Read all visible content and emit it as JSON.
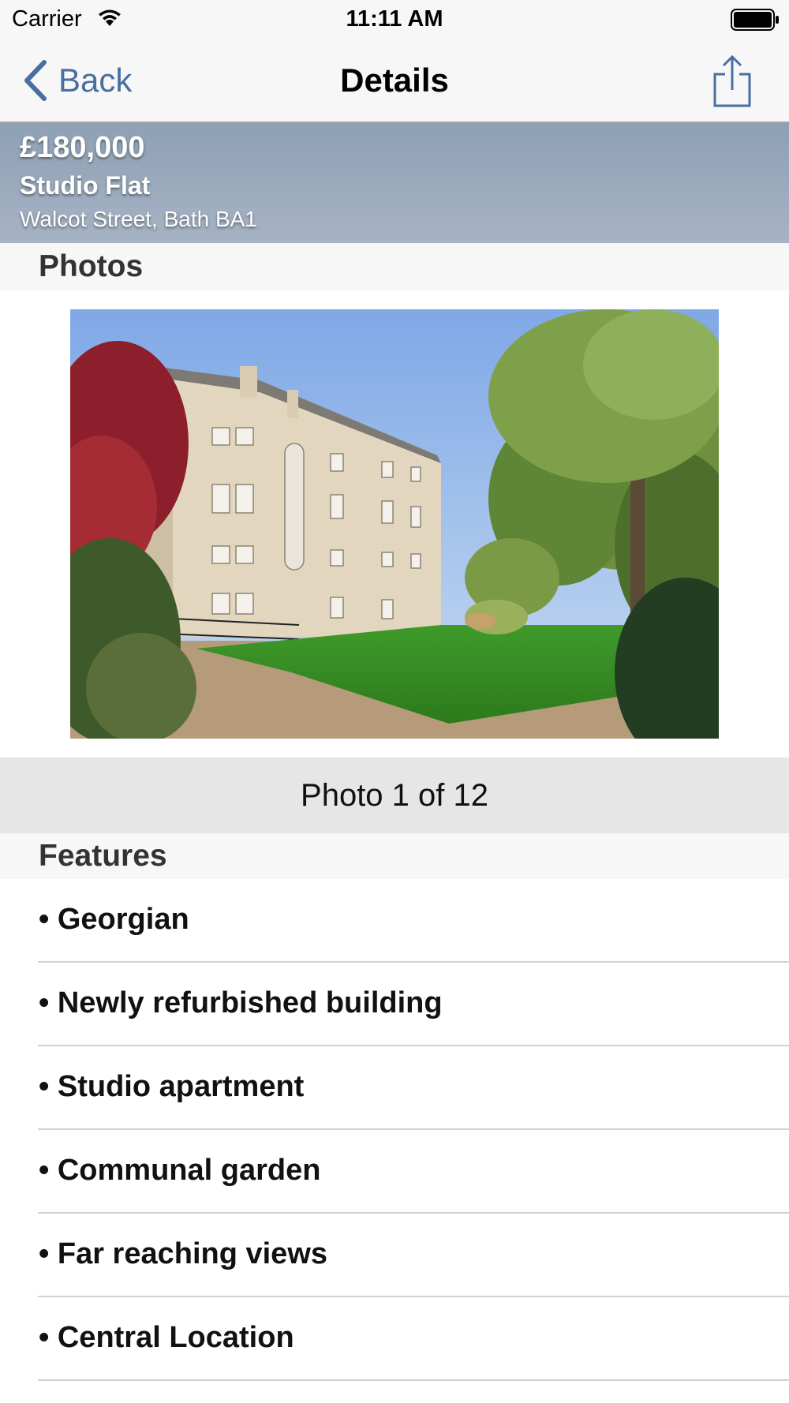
{
  "status_bar": {
    "carrier": "Carrier",
    "time": "11:11 AM"
  },
  "nav": {
    "back_label": "Back",
    "title": "Details",
    "share_icon": "share-icon"
  },
  "listing": {
    "price": "£180,000",
    "type": "Studio Flat",
    "address": "Walcot Street, Bath BA1"
  },
  "photos": {
    "section_title": "Photos",
    "counter": "Photo 1 of 12",
    "current": 1,
    "total": 12
  },
  "features": {
    "section_title": "Features",
    "items": [
      "• Georgian",
      "• Newly refurbished building",
      "• Studio apartment",
      "• Communal garden",
      "• Far reaching views",
      "• Central Location"
    ]
  },
  "colors": {
    "accent": "#4a6ea0",
    "nav_background": "#f7f7f7",
    "banner_top": "#8ea0b5",
    "banner_bottom": "#a6b3c4"
  }
}
